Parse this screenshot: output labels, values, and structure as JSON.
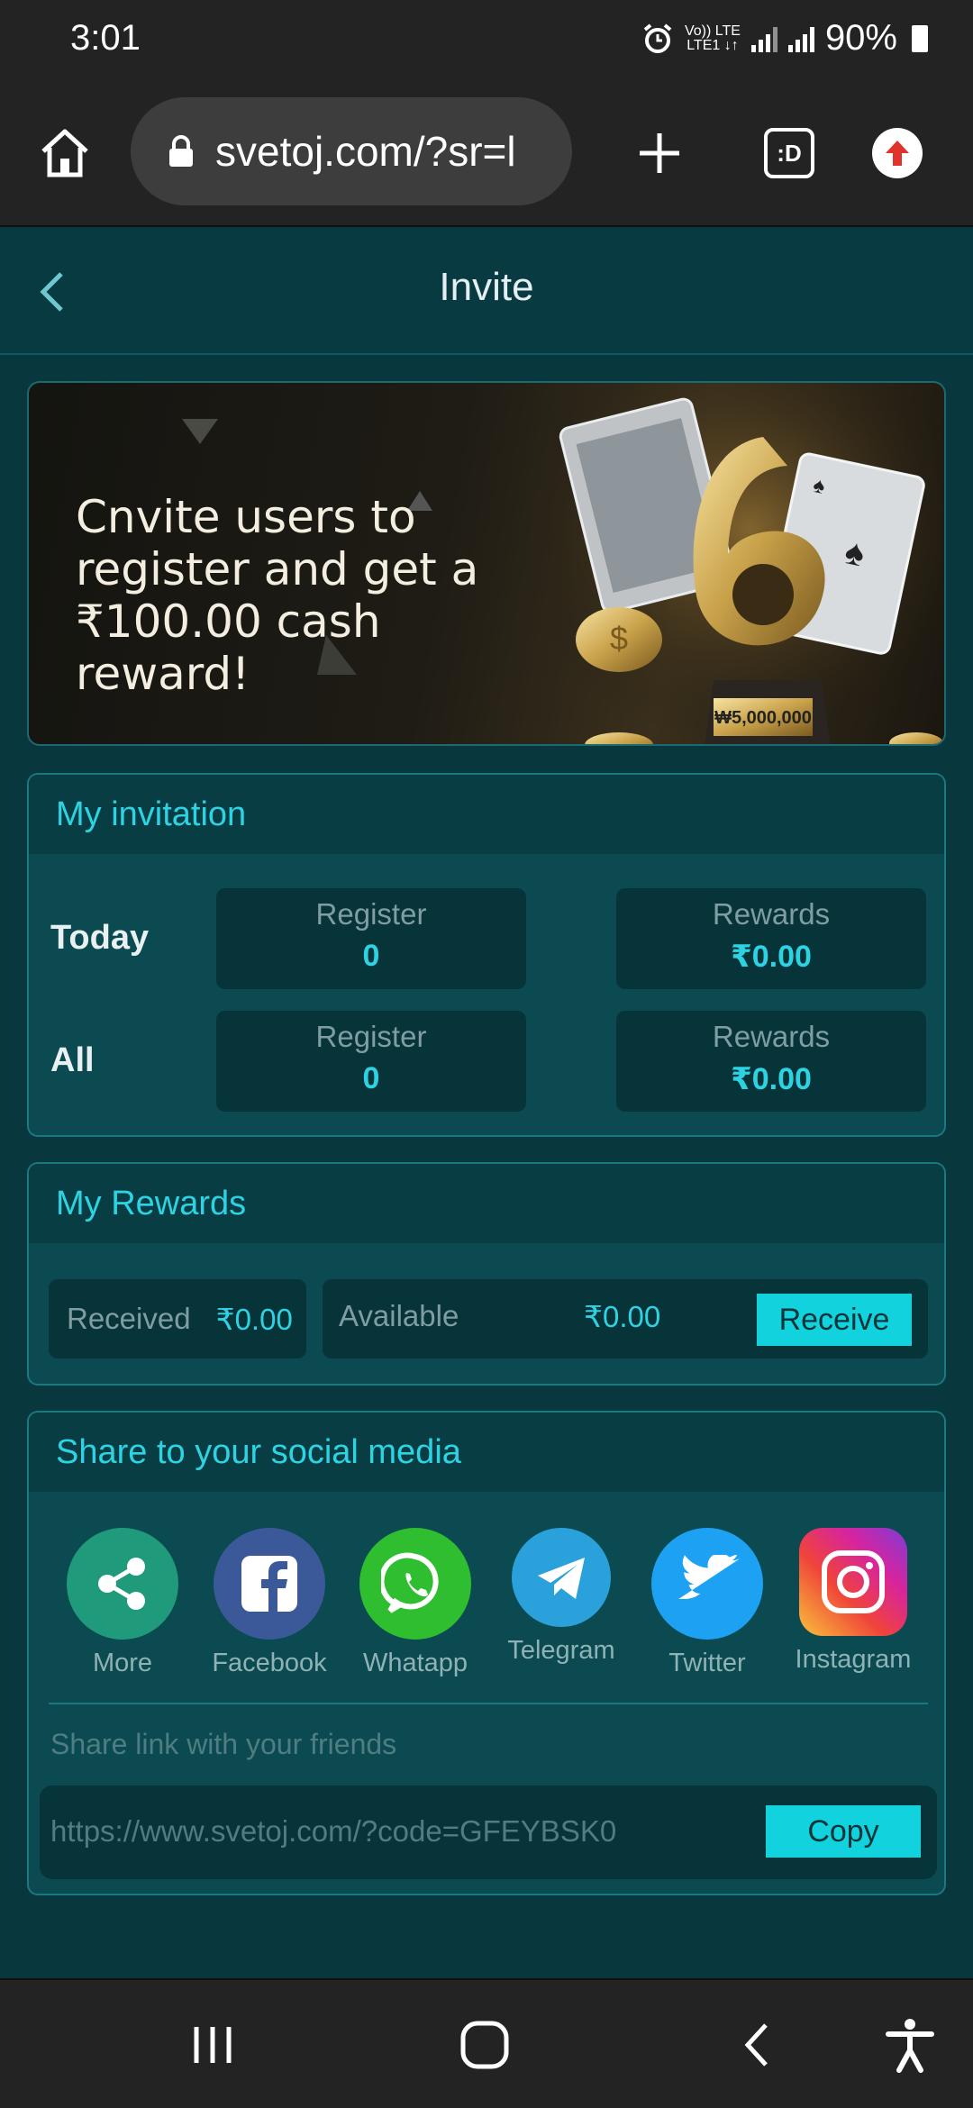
{
  "status_bar": {
    "time": "3:01",
    "network_line1": "Vo)) LTE",
    "network_line2": "LTE1 ↓↑",
    "battery": "90%"
  },
  "browser": {
    "url": "svetoj.com/?sr=l",
    "tabs_label": ":D"
  },
  "header": {
    "title": "Invite"
  },
  "banner": {
    "headline_line1": "Cnvite users to",
    "headline_line2": "register and get a",
    "headline_line3": "₹100.00 cash reward!",
    "trophy_plate": "₩5,000,000"
  },
  "invitation": {
    "title": "My invitation",
    "rows": [
      {
        "label": "Today",
        "register_label": "Register",
        "register_value": "0",
        "rewards_label": "Rewards",
        "rewards_value": "₹0.00"
      },
      {
        "label": "All",
        "register_label": "Register",
        "register_value": "0",
        "rewards_label": "Rewards",
        "rewards_value": "₹0.00"
      }
    ]
  },
  "rewards": {
    "title": "My Rewards",
    "received_label": "Received",
    "received_value": "₹0.00",
    "available_label": "Available",
    "available_value": "₹0.00",
    "receive_button": "Receive"
  },
  "share": {
    "title": "Share to your social media",
    "items": [
      {
        "label": "More",
        "icon": "share-icon",
        "color": "#1f9a7a"
      },
      {
        "label": "Facebook",
        "icon": "facebook-icon",
        "color": "#3b5998"
      },
      {
        "label": "Whatapp",
        "icon": "whatsapp-icon",
        "color": "#2fbe2f"
      },
      {
        "label": "Telegram",
        "icon": "telegram-icon",
        "color": "#2aa1da"
      },
      {
        "label": "Twitter",
        "icon": "twitter-icon",
        "color": "#1da1f2"
      },
      {
        "label": "Instagram",
        "icon": "instagram-icon",
        "color": "#d6249f"
      }
    ],
    "link_label": "Share link with your friends",
    "link": "https://www.svetoj.com/?code=GFEYBSK0",
    "copy_button": "Copy"
  },
  "colors": {
    "accent": "#12d2de",
    "background": "#08383d"
  }
}
